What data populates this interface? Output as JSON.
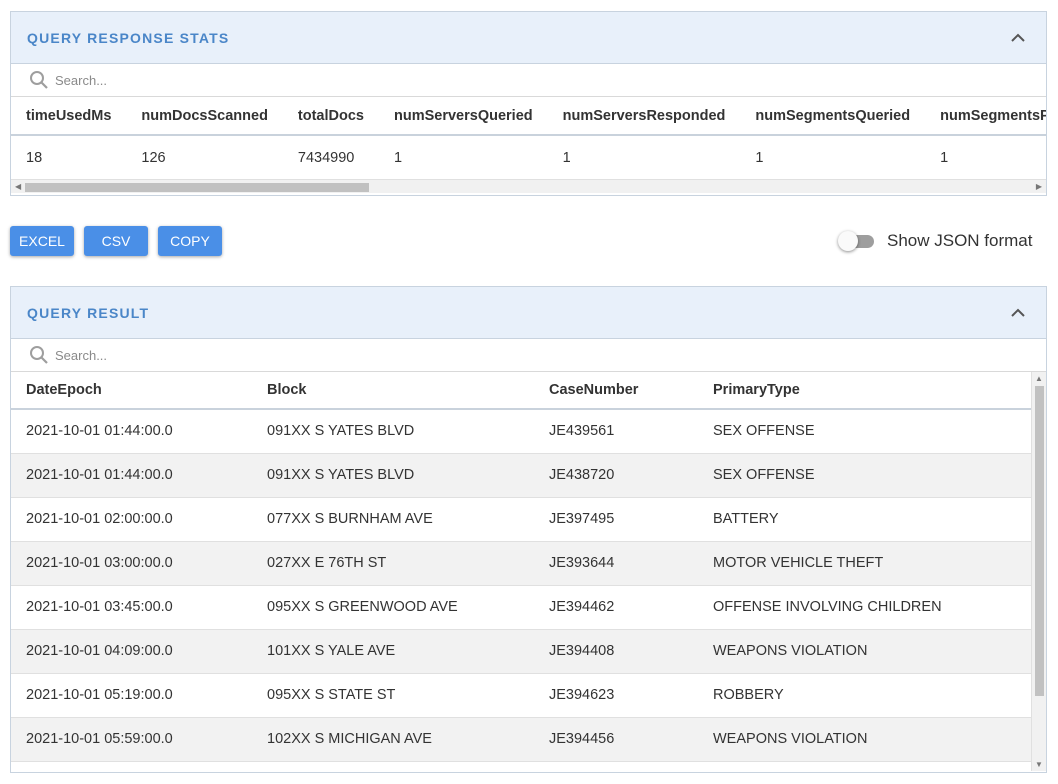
{
  "stats_panel": {
    "title": "QUERY RESPONSE STATS",
    "search_placeholder": "Search...",
    "columns": [
      "timeUsedMs",
      "numDocsScanned",
      "totalDocs",
      "numServersQueried",
      "numServersResponded",
      "numSegmentsQueried",
      "numSegmentsProcessed"
    ],
    "values": [
      "18",
      "126",
      "7434990",
      "1",
      "1",
      "1",
      "1"
    ]
  },
  "actions": {
    "excel_label": "EXCEL",
    "csv_label": "CSV",
    "copy_label": "COPY",
    "json_toggle_label": "Show JSON format",
    "json_toggle_on": false
  },
  "result_panel": {
    "title": "QUERY RESULT",
    "search_placeholder": "Search...",
    "columns": [
      "DateEpoch",
      "Block",
      "CaseNumber",
      "PrimaryType"
    ],
    "rows": [
      [
        "2021-10-01 01:44:00.0",
        "091XX S YATES BLVD",
        "JE439561",
        "SEX OFFENSE"
      ],
      [
        "2021-10-01 01:44:00.0",
        "091XX S YATES BLVD",
        "JE438720",
        "SEX OFFENSE"
      ],
      [
        "2021-10-01 02:00:00.0",
        "077XX S BURNHAM AVE",
        "JE397495",
        "BATTERY"
      ],
      [
        "2021-10-01 03:00:00.0",
        "027XX E 76TH ST",
        "JE393644",
        "MOTOR VEHICLE THEFT"
      ],
      [
        "2021-10-01 03:45:00.0",
        "095XX S GREENWOOD AVE",
        "JE394462",
        "OFFENSE INVOLVING CHILDREN"
      ],
      [
        "2021-10-01 04:09:00.0",
        "101XX S YALE AVE",
        "JE394408",
        "WEAPONS VIOLATION"
      ],
      [
        "2021-10-01 05:19:00.0",
        "095XX S STATE ST",
        "JE394623",
        "ROBBERY"
      ],
      [
        "2021-10-01 05:59:00.0",
        "102XX S MICHIGAN AVE",
        "JE394456",
        "WEAPONS VIOLATION"
      ]
    ]
  },
  "colors": {
    "accent": "#4a8fe7",
    "header_bg": "#e8f0fa",
    "title_text": "#4a86c8"
  }
}
